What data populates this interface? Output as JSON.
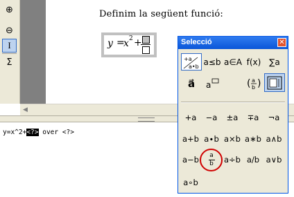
{
  "toolbar": {
    "items": [
      {
        "name": "zoom-in-icon",
        "glyph": "⊕"
      },
      {
        "name": "zoom-out-icon",
        "glyph": "⊖"
      },
      {
        "name": "cursor-icon",
        "glyph": "I",
        "active": true
      },
      {
        "name": "sigma-icon",
        "glyph": "Σ"
      }
    ]
  },
  "document": {
    "sentence": "Definim la següent funció:",
    "formula": {
      "lhs": "y",
      "eq": "=",
      "base": "x",
      "exp": "2",
      "plus": "+"
    }
  },
  "command": {
    "before": "y=x^2+",
    "selected": "<?>",
    "after": " over <?>"
  },
  "panel": {
    "title": "Selecció",
    "close_glyph": "✕",
    "categories": [
      {
        "label": "+a a•b",
        "name": "category-unary-binary"
      },
      {
        "label": "a≤b",
        "name": "category-relations"
      },
      {
        "label": "a∈A",
        "name": "category-set-operations"
      },
      {
        "label": "f(x)",
        "name": "category-functions"
      },
      {
        "label": "∑a",
        "name": "category-operators"
      },
      {
        "label": "a⃗",
        "name": "category-attributes"
      },
      {
        "label": "a",
        "name": "category-others"
      },
      {
        "label": "(a/b)",
        "name": "category-brackets"
      },
      {
        "label": "⬚",
        "name": "category-formats"
      }
    ],
    "symbols": [
      [
        "+a",
        "−a",
        "±a",
        "∓a",
        "¬a"
      ],
      [
        "a+b",
        "a∙b",
        "a×b",
        "a∗b",
        "a∧b"
      ],
      [
        "a−b",
        "a/b frac",
        "a÷b",
        "a/b",
        "a∨b"
      ],
      [
        "a∘b"
      ]
    ],
    "highlight_color": "#d00000"
  }
}
